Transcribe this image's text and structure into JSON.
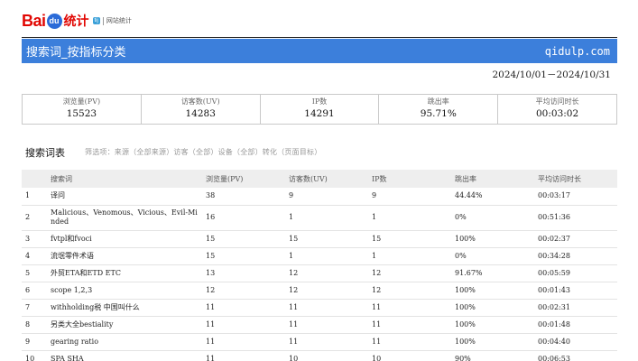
{
  "logo": {
    "part1": "Bai",
    "paw": "du",
    "part2": "统计",
    "tag": "tij",
    "site": "网站统计"
  },
  "header": {
    "title": "搜索词_按指标分类",
    "site": "qidulp.com"
  },
  "date_range": "2024/10/01－2024/10/31",
  "summary": [
    {
      "label": "浏览量(PV)",
      "value": "15523"
    },
    {
      "label": "访客数(UV)",
      "value": "14283"
    },
    {
      "label": "IP数",
      "value": "14291"
    },
    {
      "label": "跳出率",
      "value": "95.71%"
    },
    {
      "label": "平均访问时长",
      "value": "00:03:02"
    }
  ],
  "section": {
    "title": "搜索词表",
    "filter": "筛选项：来源（全部来源）访客（全部）设备（全部）转化（页面目标）"
  },
  "table": {
    "columns": [
      "",
      "搜索词",
      "浏览量(PV)",
      "访客数(UV)",
      "IP数",
      "跳出率",
      "平均访问时长"
    ],
    "rows": [
      [
        "1",
        "译问",
        "38",
        "9",
        "9",
        "44.44%",
        "00:03:17"
      ],
      [
        "2",
        "Malicious、Venomous、Vicious、Evil-Minded",
        "16",
        "1",
        "1",
        "0%",
        "00:51:36"
      ],
      [
        "3",
        "fvtpl和fvoci",
        "15",
        "15",
        "15",
        "100%",
        "00:02:37"
      ],
      [
        "4",
        "流氓零件术语",
        "15",
        "1",
        "1",
        "0%",
        "00:34:28"
      ],
      [
        "5",
        "外贸ETA和ETD ETC",
        "13",
        "12",
        "12",
        "91.67%",
        "00:05:59"
      ],
      [
        "6",
        "scope 1,2,3",
        "12",
        "12",
        "12",
        "100%",
        "00:01:43"
      ],
      [
        "7",
        "withholding税 中国叫什么",
        "11",
        "11",
        "11",
        "100%",
        "00:02:31"
      ],
      [
        "8",
        "另类大全bestiality",
        "11",
        "11",
        "11",
        "100%",
        "00:01:48"
      ],
      [
        "9",
        "gearing ratio",
        "11",
        "11",
        "11",
        "100%",
        "00:04:40"
      ],
      [
        "10",
        "SPA SHA",
        "11",
        "10",
        "10",
        "90%",
        "00:06:53"
      ]
    ]
  }
}
